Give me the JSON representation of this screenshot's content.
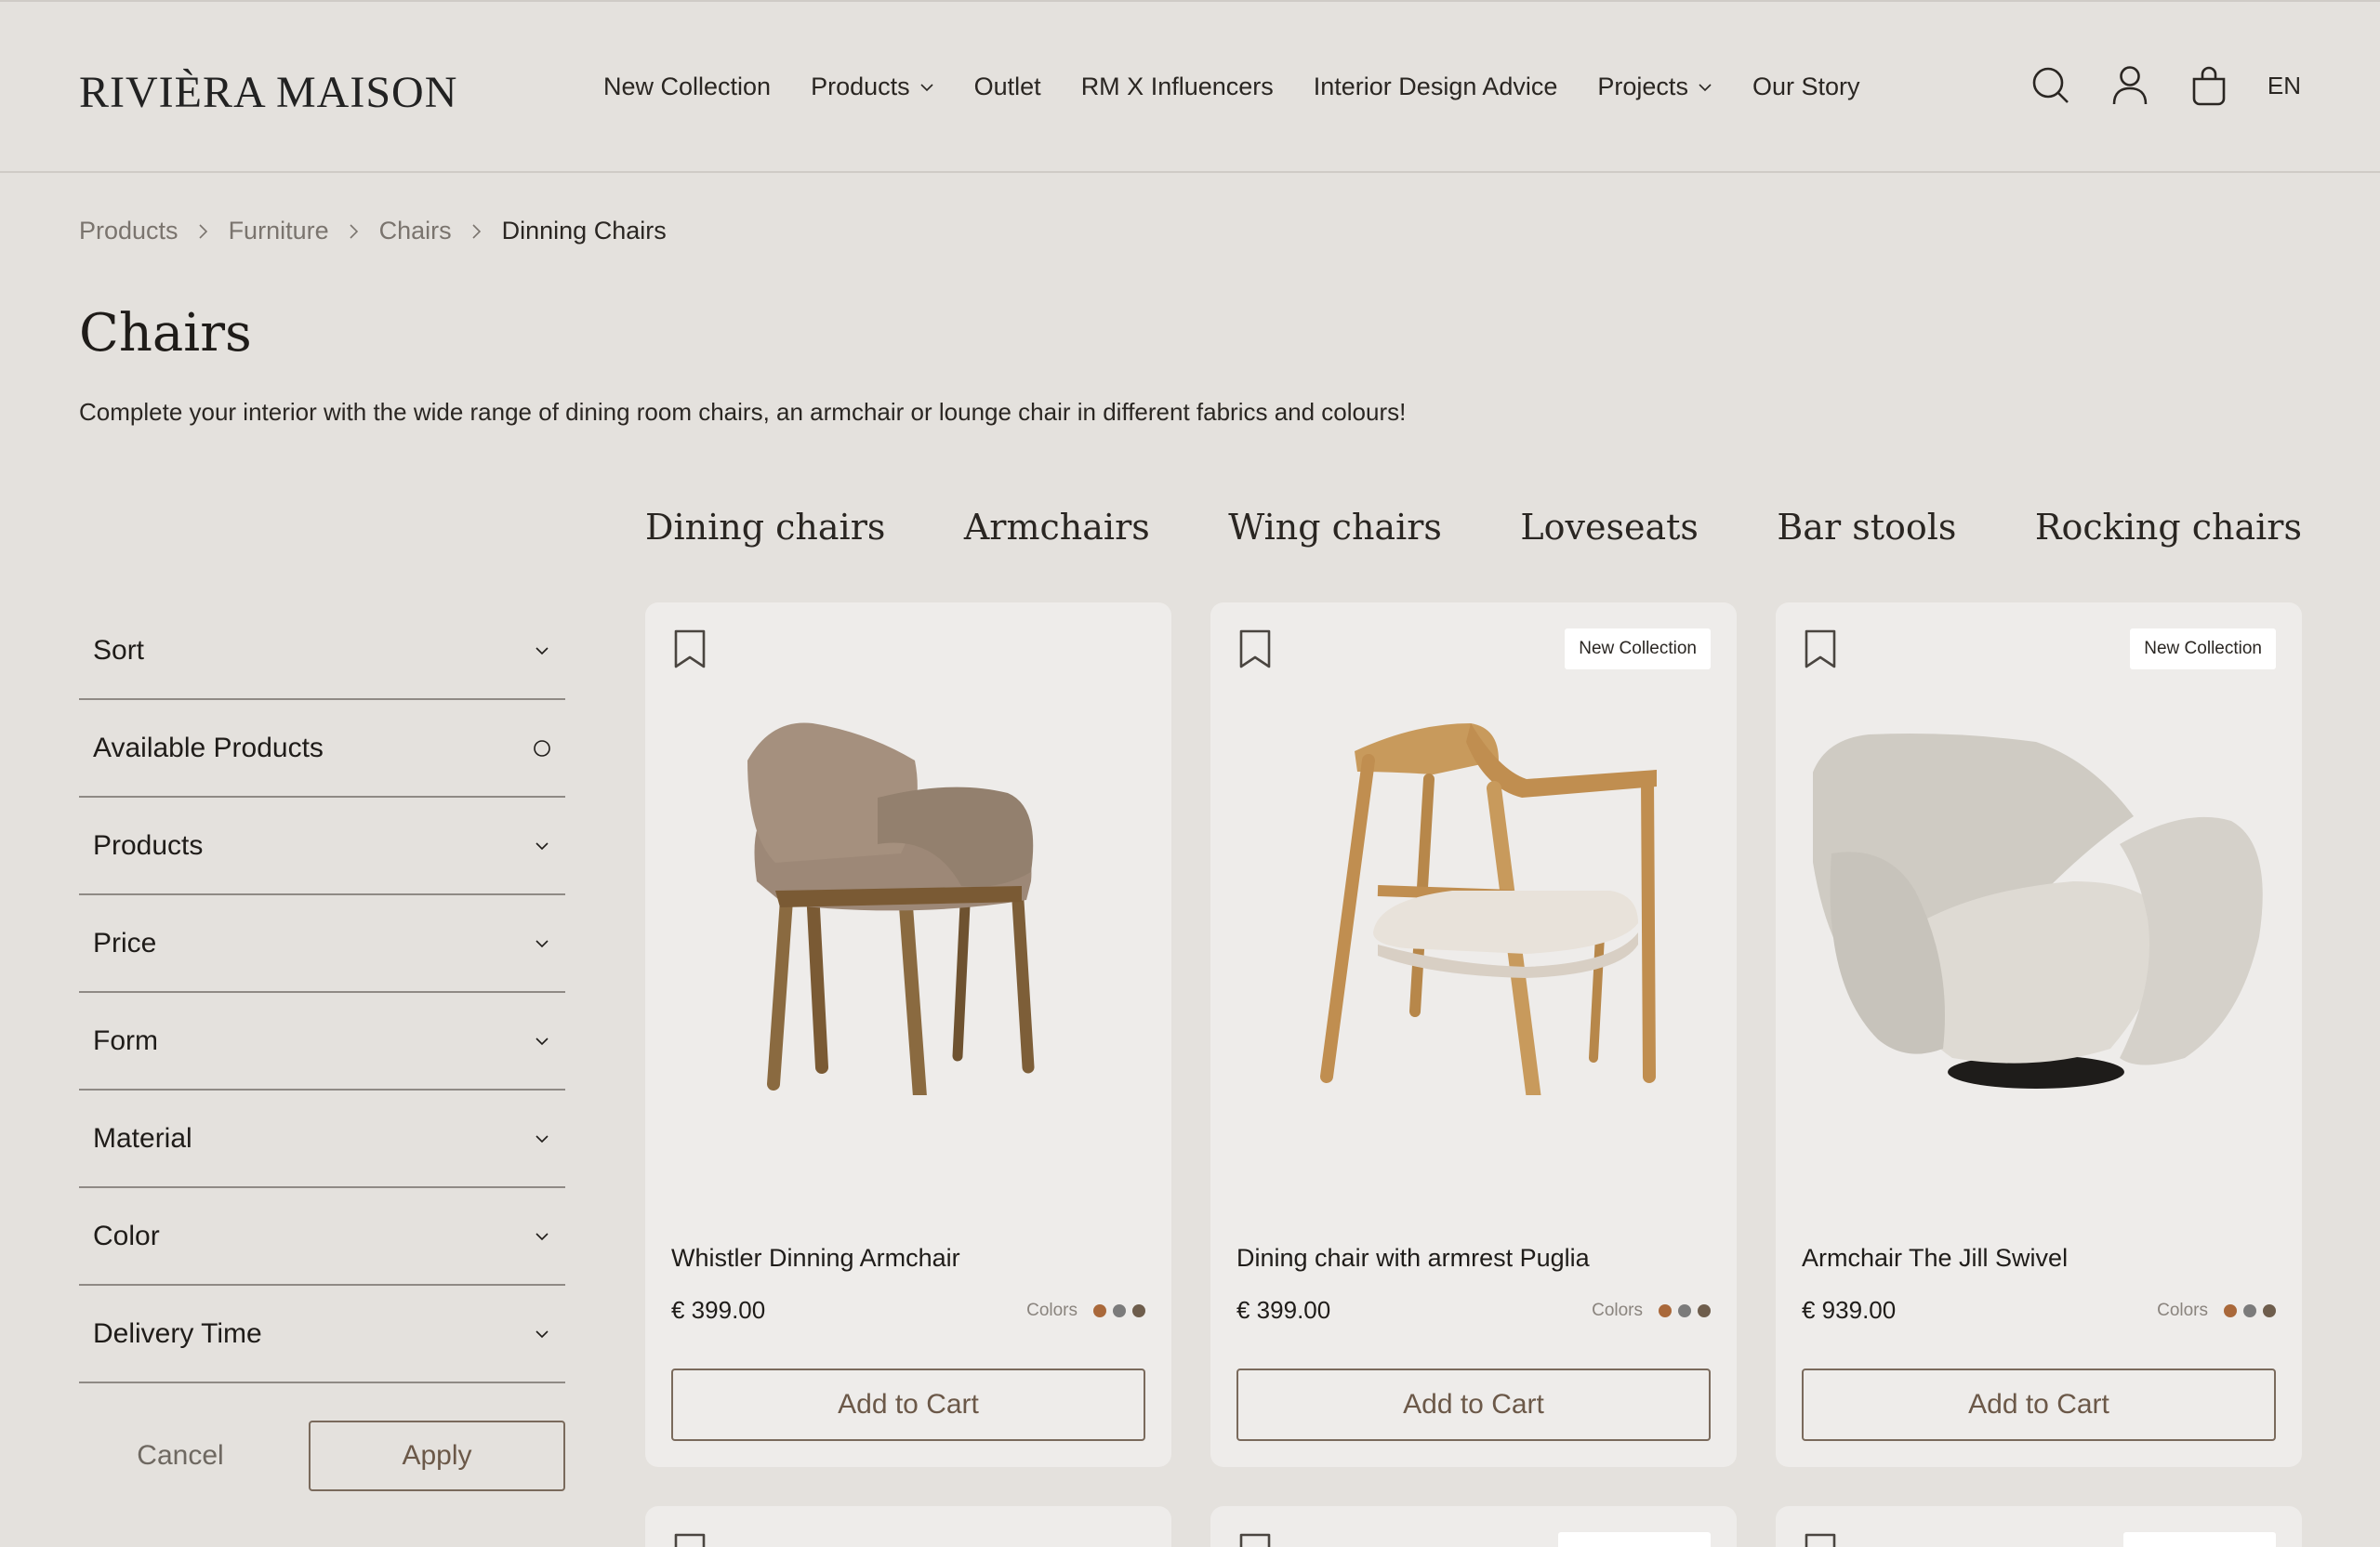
{
  "header": {
    "logo": "RIVIÈRA MAISON",
    "nav": [
      {
        "label": "New Collection",
        "dropdown": false
      },
      {
        "label": "Products",
        "dropdown": true
      },
      {
        "label": "Outlet",
        "dropdown": false
      },
      {
        "label": "RM X Influencers",
        "dropdown": false
      },
      {
        "label": "Interior Design Advice",
        "dropdown": false
      },
      {
        "label": "Projects",
        "dropdown": true
      },
      {
        "label": "Our Story",
        "dropdown": false
      }
    ],
    "icons": [
      "search-icon",
      "user-icon",
      "bag-icon"
    ],
    "language": "EN"
  },
  "breadcrumb": [
    "Products",
    "Furniture",
    "Chairs",
    "Dinning Chairs"
  ],
  "page": {
    "title": "Chairs",
    "description": "Complete your interior with the wide range of dining room chairs, an armchair or lounge chair in different fabrics and colours!"
  },
  "categories": [
    "Dining chairs",
    "Armchairs",
    "Wing chairs",
    "Loveseats",
    "Bar stools",
    "Rocking chairs"
  ],
  "filters": {
    "items": [
      {
        "label": "Sort",
        "icon": "chevron-down-icon"
      },
      {
        "label": "Available Products",
        "icon": "radio-icon"
      },
      {
        "label": "Products",
        "icon": "chevron-down-icon"
      },
      {
        "label": "Price",
        "icon": "chevron-down-icon"
      },
      {
        "label": "Form",
        "icon": "chevron-down-icon"
      },
      {
        "label": "Material",
        "icon": "chevron-down-icon"
      },
      {
        "label": "Color",
        "icon": "chevron-down-icon"
      },
      {
        "label": "Delivery Time",
        "icon": "chevron-down-icon"
      }
    ],
    "cancel_label": "Cancel",
    "apply_label": "Apply"
  },
  "products": [
    {
      "name": "Whistler Dinning Armchair",
      "price": "€ 399.00",
      "badge": "",
      "colors_label": "Colors",
      "swatches": [
        "#a9683a",
        "#7b7b7b",
        "#6e5d4c"
      ],
      "add_label": "Add to Cart"
    },
    {
      "name": "Dining chair with armrest Puglia",
      "price": "€ 399.00",
      "badge": "New Collection",
      "colors_label": "Colors",
      "swatches": [
        "#a9683a",
        "#7b7b7b",
        "#6e5d4c"
      ],
      "add_label": "Add to Cart"
    },
    {
      "name": "Armchair The Jill Swivel",
      "price": "€ 939.00",
      "badge": "New Collection",
      "colors_label": "Colors",
      "swatches": [
        "#a9683a",
        "#7b7b7b",
        "#6e5d4c"
      ],
      "add_label": "Add to Cart"
    }
  ],
  "colors": {
    "background": "#e4e1dd",
    "card": "#eeecea",
    "button_border": "#7a6a5c",
    "button_text": "#6b5848"
  }
}
